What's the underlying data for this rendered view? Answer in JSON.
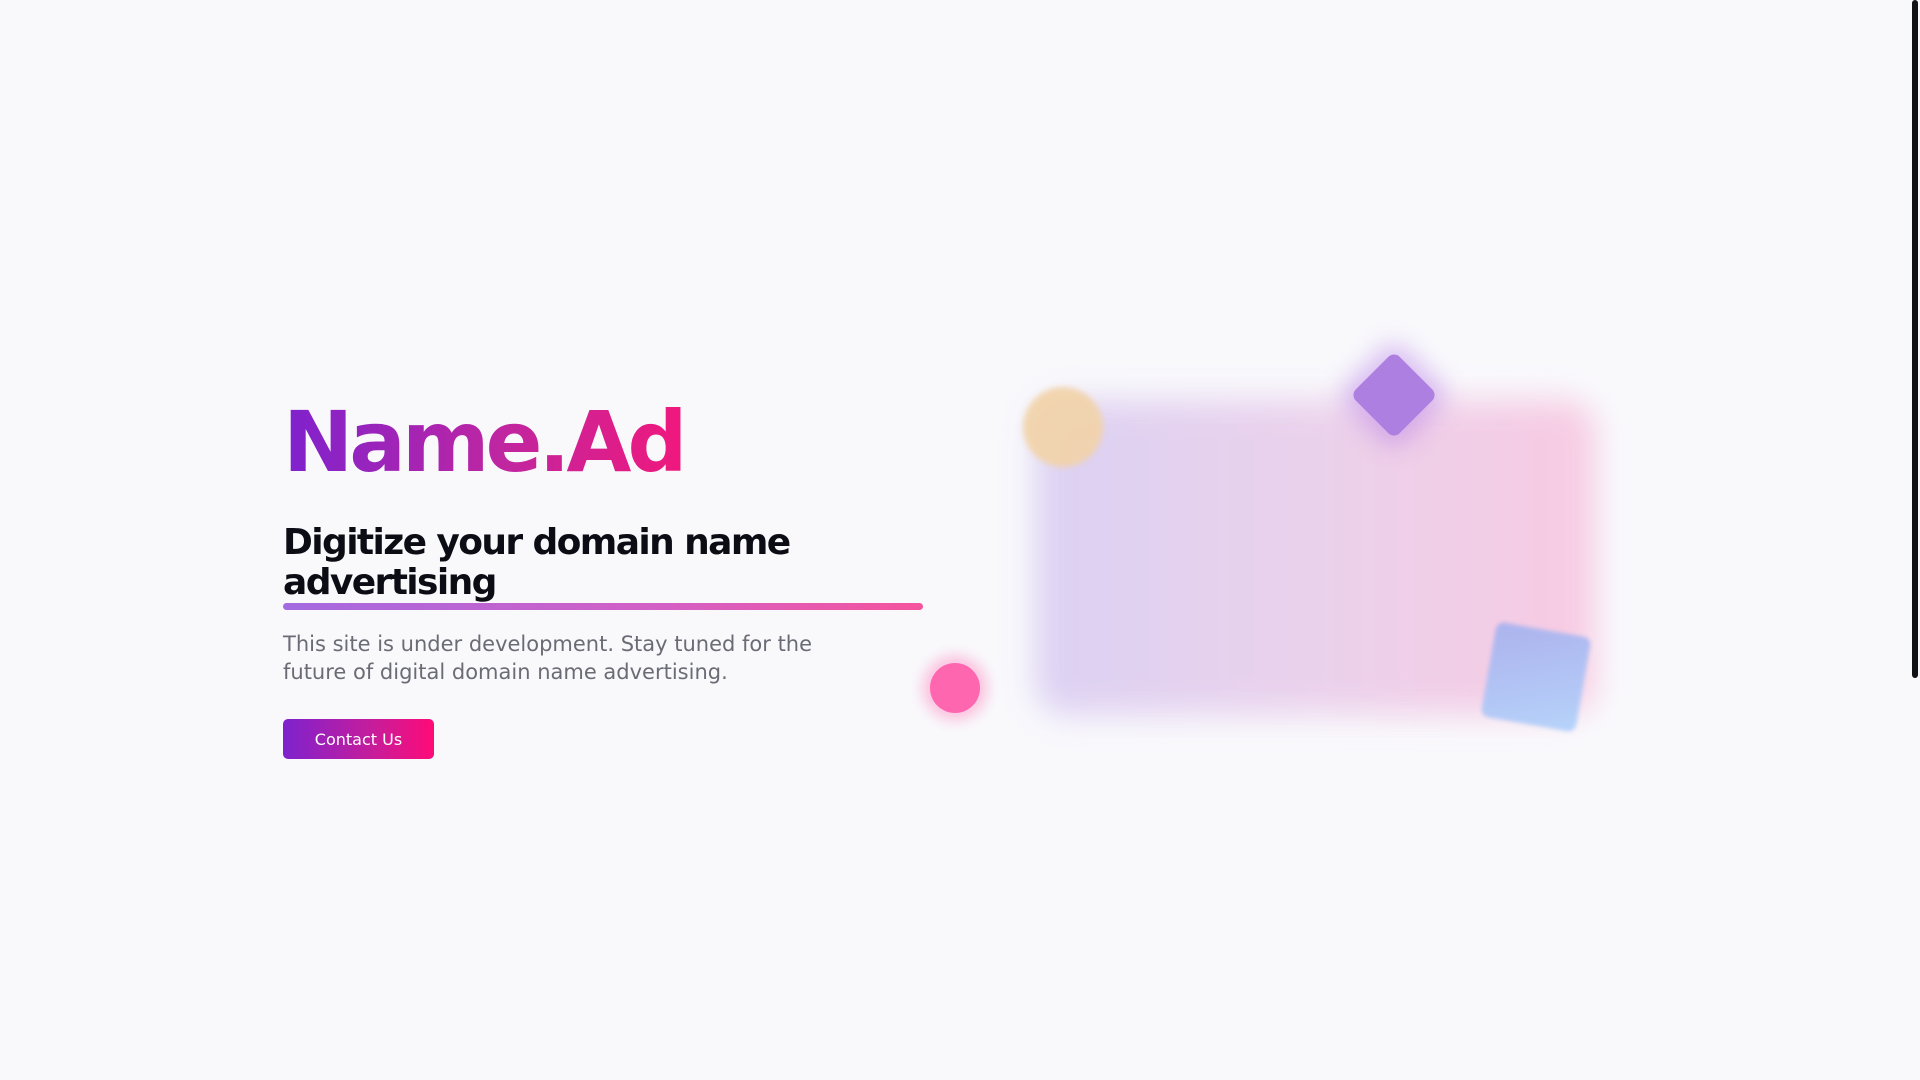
{
  "hero": {
    "logo": "Name.Ad",
    "tagline": "Digitize your domain name advertising",
    "description": "This site is under development. Stay tuned for the future of digital domain name advertising.",
    "cta_label": "Contact Us"
  },
  "colors": {
    "background": "#f9f9fc",
    "brand_purple": "#7e22ce",
    "brand_pink": "#f0187c",
    "text_dark": "#0c0c14",
    "text_muted": "#6b6b76"
  }
}
